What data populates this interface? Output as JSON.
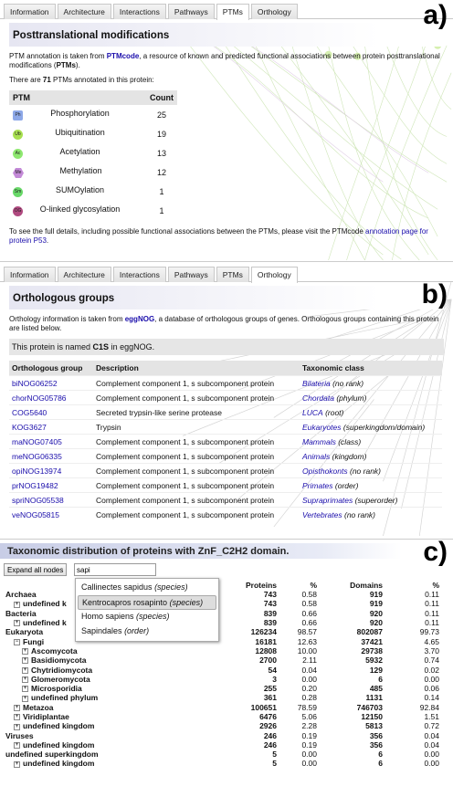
{
  "panel_labels": {
    "a": "a)",
    "b": "b)",
    "c": "c)"
  },
  "tabs": [
    "Information",
    "Architecture",
    "Interactions",
    "Pathways",
    "PTMs",
    "Orthology"
  ],
  "panel_a": {
    "active_tab": "PTMs",
    "title": "Posttranslational modifications",
    "intro_pre": "PTM annotation is taken from ",
    "intro_link": "PTMcode",
    "intro_mid": ", a resource of known and predicted functional associations between protein posttranslational modifications (",
    "intro_bold": "PTMs",
    "intro_post": ").",
    "count_pre": "There are ",
    "count_num": "71",
    "count_post": " PTMs annotated in this protein:",
    "table_headers": [
      "PTM",
      "Count"
    ],
    "rows": [
      {
        "icon": "Ph",
        "icon_name": "phosphorylation-icon",
        "color": "#8da8e8",
        "shape": "square",
        "name": "Phosphorylation",
        "count": "25"
      },
      {
        "icon": "Ub",
        "icon_name": "ubiquitination-icon",
        "color": "#a8e050",
        "shape": "circle",
        "name": "Ubiquitination",
        "count": "19"
      },
      {
        "icon": "Ac",
        "icon_name": "acetylation-icon",
        "color": "#8ee870",
        "shape": "circle",
        "name": "Acetylation",
        "count": "13"
      },
      {
        "icon": "Me",
        "icon_name": "methylation-icon",
        "color": "#c48ad8",
        "shape": "hexagon",
        "name": "Methylation",
        "count": "12"
      },
      {
        "icon": "Sm",
        "icon_name": "sumoylation-icon",
        "color": "#68d868",
        "shape": "circle",
        "name": "SUMOylation",
        "count": "1"
      },
      {
        "icon": "OG",
        "icon_name": "o-glycosylation-icon",
        "color": "#b04a80",
        "shape": "circle",
        "name": "O-linked glycosylation",
        "count": "1"
      }
    ],
    "footer_pre": "To see the full details, including possible functional associations between the PTMs, please visit the PTMcode ",
    "footer_link1": "annotation page for",
    "footer_link2": "protein P53",
    "footer_post": "."
  },
  "panel_b": {
    "active_tab": "Orthology",
    "title": "Orthologous groups",
    "intro_pre": "Orthology information is taken from ",
    "intro_link": "eggNOG",
    "intro_post": ", a database of orthologous groups of genes. Orthologous groups containing this protein are listed below.",
    "named_pre": "This protein is named ",
    "named_bold": "C1S",
    "named_post": " in eggNOG.",
    "table_headers": [
      "Orthologous group",
      "Description",
      "Taxonomic class"
    ],
    "rows": [
      {
        "group": "biNOG06252",
        "desc": "Complement component 1, s subcomponent protein",
        "taxon": "Bilateria",
        "rank": "(no rank)"
      },
      {
        "group": "chorNOG05786",
        "desc": "Complement component 1, s subcomponent protein",
        "taxon": "Chordata",
        "rank": "(phylum)"
      },
      {
        "group": "COG5640",
        "desc": "Secreted trypsin-like serine protease",
        "taxon": "LUCA",
        "rank": "(root)"
      },
      {
        "group": "KOG3627",
        "desc": "Trypsin",
        "taxon": "Eukaryotes",
        "rank": "(superkingdom/domain)"
      },
      {
        "group": "maNOG07405",
        "desc": "Complement component 1, s subcomponent protein",
        "taxon": "Mammals",
        "rank": "(class)"
      },
      {
        "group": "meNOG06335",
        "desc": "Complement component 1, s subcomponent protein",
        "taxon": "Animals",
        "rank": "(kingdom)"
      },
      {
        "group": "opiNOG13974",
        "desc": "Complement component 1, s subcomponent protein",
        "taxon": "Opisthokonts",
        "rank": "(no rank)"
      },
      {
        "group": "prNOG19482",
        "desc": "Complement component 1, s subcomponent protein",
        "taxon": "Primates",
        "rank": "(order)"
      },
      {
        "group": "spriNOG05538",
        "desc": "Complement component 1, s subcomponent protein",
        "taxon": "Supraprimates",
        "rank": "(superorder)"
      },
      {
        "group": "veNOG05815",
        "desc": "Complement component 1, s subcomponent protein",
        "taxon": "Vertebrates",
        "rank": "(no rank)"
      }
    ]
  },
  "panel_c": {
    "title": "Taxonomic distribution of proteins with ZnF_C2H2 domain.",
    "expand_button": "Expand all nodes",
    "search_value": "sapi",
    "dropdown": [
      {
        "name": "Callinectes sapidus",
        "rank": "(species)",
        "selected": false
      },
      {
        "name": "Kentrocapros rosapinto",
        "rank": "(species)",
        "selected": true
      },
      {
        "name": "Homo sapiens",
        "rank": "(species)",
        "selected": false
      },
      {
        "name": "Sapindales",
        "rank": "(order)",
        "selected": false
      }
    ],
    "headers": [
      "Proteins",
      "%",
      "Domains",
      "%"
    ],
    "rows": [
      {
        "name": "Archaea",
        "toggle": "",
        "depth": 0,
        "proteins": "743",
        "pp": "0.58",
        "domains": "919",
        "dp": "0.11"
      },
      {
        "name": "undefined k",
        "toggle": "+",
        "depth": 1,
        "proteins": "743",
        "pp": "0.58",
        "domains": "919",
        "dp": "0.11"
      },
      {
        "name": "Bacteria",
        "toggle": "",
        "depth": 0,
        "proteins": "839",
        "pp": "0.66",
        "domains": "920",
        "dp": "0.11"
      },
      {
        "name": "undefined k",
        "toggle": "+",
        "depth": 1,
        "proteins": "839",
        "pp": "0.66",
        "domains": "920",
        "dp": "0.11"
      },
      {
        "name": "Eukaryota",
        "toggle": "",
        "depth": 0,
        "proteins": "126234",
        "pp": "98.57",
        "domains": "802087",
        "dp": "99.73"
      },
      {
        "name": "Fungi",
        "toggle": "−",
        "depth": 1,
        "proteins": "16181",
        "pp": "12.63",
        "domains": "37421",
        "dp": "4.65"
      },
      {
        "name": "Ascomycota",
        "toggle": "+",
        "depth": 2,
        "proteins": "12808",
        "pp": "10.00",
        "domains": "29738",
        "dp": "3.70"
      },
      {
        "name": "Basidiomycota",
        "toggle": "+",
        "depth": 2,
        "proteins": "2700",
        "pp": "2.11",
        "domains": "5932",
        "dp": "0.74"
      },
      {
        "name": "Chytridiomycota",
        "toggle": "+",
        "depth": 2,
        "proteins": "54",
        "pp": "0.04",
        "domains": "129",
        "dp": "0.02"
      },
      {
        "name": "Glomeromycota",
        "toggle": "+",
        "depth": 2,
        "proteins": "3",
        "pp": "0.00",
        "domains": "6",
        "dp": "0.00"
      },
      {
        "name": "Microsporidia",
        "toggle": "+",
        "depth": 2,
        "proteins": "255",
        "pp": "0.20",
        "domains": "485",
        "dp": "0.06"
      },
      {
        "name": "undefined phylum",
        "toggle": "+",
        "depth": 2,
        "proteins": "361",
        "pp": "0.28",
        "domains": "1131",
        "dp": "0.14"
      },
      {
        "name": "Metazoa",
        "toggle": "+",
        "depth": 1,
        "proteins": "100651",
        "pp": "78.59",
        "domains": "746703",
        "dp": "92.84"
      },
      {
        "name": "Viridiplantae",
        "toggle": "+",
        "depth": 1,
        "proteins": "6476",
        "pp": "5.06",
        "domains": "12150",
        "dp": "1.51"
      },
      {
        "name": "undefined kingdom",
        "toggle": "+",
        "depth": 1,
        "proteins": "2926",
        "pp": "2.28",
        "domains": "5813",
        "dp": "0.72"
      },
      {
        "name": "Viruses",
        "toggle": "",
        "depth": 0,
        "proteins": "246",
        "pp": "0.19",
        "domains": "356",
        "dp": "0.04"
      },
      {
        "name": "undefined kingdom",
        "toggle": "+",
        "depth": 1,
        "proteins": "246",
        "pp": "0.19",
        "domains": "356",
        "dp": "0.04"
      },
      {
        "name": "undefined superkingdom",
        "toggle": "",
        "depth": 0,
        "proteins": "5",
        "pp": "0.00",
        "domains": "6",
        "dp": "0.00"
      },
      {
        "name": "undefined kingdom",
        "toggle": "+",
        "depth": 1,
        "proteins": "5",
        "pp": "0.00",
        "domains": "6",
        "dp": "0.00"
      }
    ]
  }
}
